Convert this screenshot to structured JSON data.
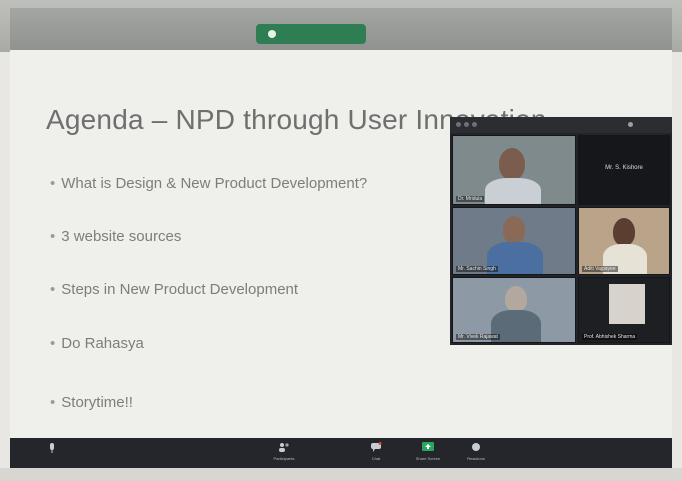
{
  "slide": {
    "title": "Agenda – NPD through User Innovation",
    "bullets": [
      "What is Design & New Product Development?",
      "3 website sources",
      "Steps in New Product Development",
      "Do Rahasya",
      "Storytime!!"
    ]
  },
  "participants": [
    {
      "name": "Dr. Mridula"
    },
    {
      "name": "Mr. S. Kishore"
    },
    {
      "name": "Mr. Sachin Singh"
    },
    {
      "name": "Aditi Vajpayee"
    },
    {
      "name": "Mr. Vivek Rajawat"
    },
    {
      "name": "Prof. Abhishek Sharma"
    }
  ],
  "toolbar": {
    "items": [
      {
        "label": "Participants",
        "icon": "participants-icon"
      },
      {
        "label": "Chat",
        "icon": "chat-icon"
      },
      {
        "label": "Share Screen",
        "icon": "share-screen-icon"
      },
      {
        "label": "Reactions",
        "icon": "reactions-icon"
      }
    ]
  },
  "colors": {
    "toolbar_bg": "#24262b",
    "share_green": "#2f7d53",
    "slide_bg": "#efefec",
    "text_grey": "#7d7d7b"
  }
}
